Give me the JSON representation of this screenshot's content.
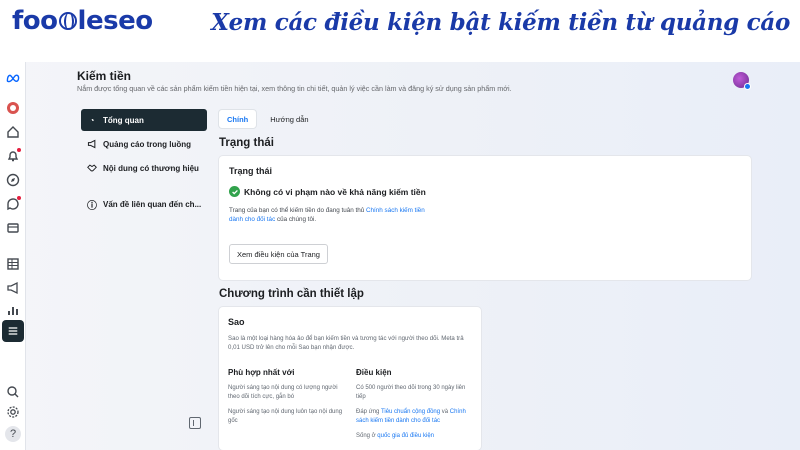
{
  "banner": {
    "logo_text_1": "foo",
    "logo_text_2": "leseo",
    "title": "Xem các điều kiện bật kiếm tiền từ quảng cáo"
  },
  "header": {
    "title": "Kiếm tiền",
    "description": "Nắm được tổng quan về các sản phẩm kiếm tiền hiện tại, xem thông tin chi tiết, quản lý việc cần làm và đăng ký sử dụng sản phẩm mới."
  },
  "menu": {
    "items": [
      {
        "label": "Tổng quan",
        "icon": "dashboard-icon",
        "glyph": "◔"
      },
      {
        "label": "Quảng cáo trong luồng",
        "icon": "megaphone-icon",
        "glyph": "📢"
      },
      {
        "label": "Nội dung có thương hiệu",
        "icon": "handshake-icon",
        "glyph": "🤝"
      },
      {
        "label": "Vấn đề liên quan đến ch...",
        "icon": "info-icon",
        "glyph": "ⓘ"
      }
    ]
  },
  "tabs": [
    {
      "label": "Chính"
    },
    {
      "label": "Hướng dẫn"
    }
  ],
  "status": {
    "section_title": "Trạng thái",
    "card_title": "Trạng thái",
    "ok_message": "Không có vi phạm nào về khả năng kiếm tiền",
    "note_prefix": "Trang của bạn có thể kiếm tiền do đang tuân thủ ",
    "note_link": "Chính sách kiếm tiền dành cho đối tác",
    "note_suffix": " của chúng tôi.",
    "button_label": "Xem điều kiện của Trang"
  },
  "programs": {
    "section_title": "Chương trình cần thiết lập",
    "card_title": "Sao",
    "description": "Sao là một loại hàng hóa ảo để bạn kiếm tiền và tương tác với người theo dõi. Meta trả 0,01 USD trở lên cho mỗi Sao bạn nhận được.",
    "fit_heading": "Phù hợp nhất với",
    "fit_items": [
      "Người sáng tạo nội dung có lượng người theo dõi tích cực, gắn bó",
      "Người sáng tạo nội dung luôn tạo nội dung gốc"
    ],
    "cond_heading": "Điều kiện",
    "cond_item_1": "Có 500 người theo dõi trong 30 ngày liên tiếp",
    "cond_item_2_prefix": "Đáp ứng ",
    "cond_item_2_link1": "Tiêu chuẩn cộng đồng",
    "cond_item_2_mid": " và ",
    "cond_item_2_link2": "Chính sách kiếm tiền dành cho đối tác",
    "cond_item_3_prefix": "Sống ở ",
    "cond_item_3_link": "quốc gia đủ điều kiện"
  },
  "colors": {
    "brand_blue": "#1a3aa8",
    "meta_blue": "#1877f2",
    "active_dark": "#1c2b33",
    "success_green": "#31a24c"
  }
}
